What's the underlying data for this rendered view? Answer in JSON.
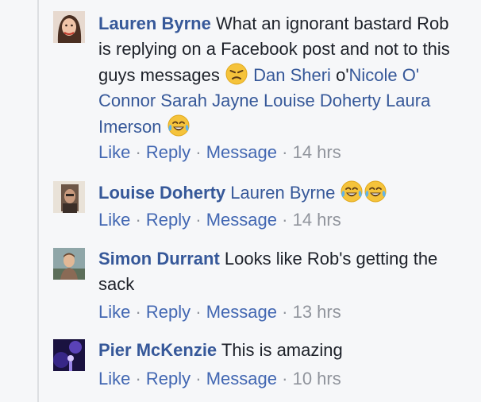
{
  "comments": [
    {
      "author": "Lauren Byrne",
      "text1": "What an ignorant bastard Rob is replying on a Facebook post and not to this guys messages",
      "emoji1": "angry-face",
      "mention1": "Dan Sheri",
      "text2": "o'",
      "mention2": "Nicole O' Connor",
      "mention3": "Sarah Jayne",
      "mention4": "Louise Doherty",
      "mention5": "Laura Imerson",
      "emoji2": "tears-of-joy",
      "actions": {
        "like": "Like",
        "reply": "Reply",
        "message": "Message",
        "time": "14 hrs"
      }
    },
    {
      "author": "Louise Doherty",
      "mention1": "Lauren Byrne",
      "emoji1": "tears-of-joy",
      "emoji2": "tears-of-joy",
      "actions": {
        "like": "Like",
        "reply": "Reply",
        "message": "Message",
        "time": "14 hrs"
      }
    },
    {
      "author": "Simon Durrant",
      "text1": "Looks like Rob's getting the sack",
      "actions": {
        "like": "Like",
        "reply": "Reply",
        "message": "Message",
        "time": "13 hrs"
      }
    },
    {
      "author": "Pier McKenzie",
      "text1": "This is amazing",
      "actions": {
        "like": "Like",
        "reply": "Reply",
        "message": "Message",
        "time": "10 hrs"
      }
    }
  ],
  "separator": " · ",
  "colors": {
    "link": "#365899",
    "action": "#4267b2",
    "meta": "#90949c",
    "text": "#1d2129"
  }
}
